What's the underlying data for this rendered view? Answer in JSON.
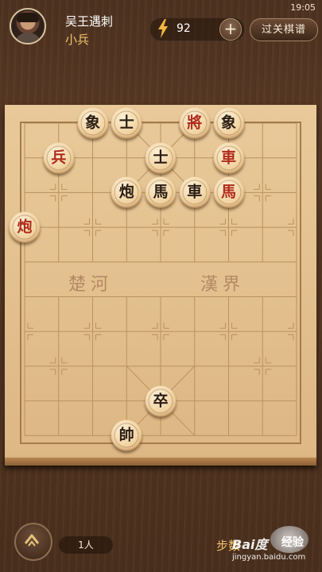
{
  "status": {
    "time": "19:05"
  },
  "player": {
    "name": "吴王遇刺",
    "rank": "小兵"
  },
  "energy": {
    "value": "92",
    "plus": "+"
  },
  "header": {
    "record_button": "过关棋谱"
  },
  "board": {
    "river_left": "楚河",
    "river_right": "漢界",
    "pieces": [
      {
        "label": "象",
        "side": "black",
        "col": 2,
        "row": 0
      },
      {
        "label": "士",
        "side": "black",
        "col": 3,
        "row": 0
      },
      {
        "label": "將",
        "side": "red",
        "col": 5,
        "row": 0
      },
      {
        "label": "象",
        "side": "black",
        "col": 6,
        "row": 0
      },
      {
        "label": "兵",
        "side": "red",
        "col": 1,
        "row": 1
      },
      {
        "label": "士",
        "side": "black",
        "col": 4,
        "row": 1
      },
      {
        "label": "車",
        "side": "red",
        "col": 6,
        "row": 1
      },
      {
        "label": "炮",
        "side": "black",
        "col": 3,
        "row": 2
      },
      {
        "label": "馬",
        "side": "black",
        "col": 4,
        "row": 2
      },
      {
        "label": "車",
        "side": "black",
        "col": 5,
        "row": 2
      },
      {
        "label": "馬",
        "side": "red",
        "col": 6,
        "row": 2
      },
      {
        "label": "炮",
        "side": "red",
        "col": 0,
        "row": 3
      },
      {
        "label": "卒",
        "side": "black",
        "col": 4,
        "row": 8
      },
      {
        "label": "帥",
        "side": "black",
        "col": 3,
        "row": 9
      }
    ]
  },
  "footer": {
    "people": "1人",
    "steps_label": "步数"
  },
  "watermark": {
    "logo": "Bai度",
    "badge": "经验",
    "url": "jingyan.baidu.com"
  }
}
